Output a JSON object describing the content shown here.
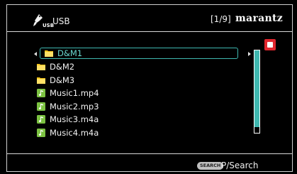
{
  "header": {
    "source_icon": "usb-plug-icon",
    "source_sub_label": "USB",
    "source_name": "USB",
    "page_indicator": "[1/9]",
    "brand": "marantz"
  },
  "list": {
    "items": [
      {
        "label": "D&M1",
        "type": "folder",
        "icon": "folder-icon",
        "selected": true
      },
      {
        "label": "D&M2",
        "type": "folder",
        "icon": "folder-icon",
        "selected": false
      },
      {
        "label": "D&M3",
        "type": "folder",
        "icon": "folder-icon",
        "selected": false
      },
      {
        "label": "Music1.mp4",
        "type": "music",
        "icon": "music-note-icon",
        "selected": false
      },
      {
        "label": "Music2.mp3",
        "type": "music",
        "icon": "music-note-icon",
        "selected": false
      },
      {
        "label": "Music3.m4a",
        "type": "music",
        "icon": "music-note-icon",
        "selected": false
      },
      {
        "label": "Music4.m4a",
        "type": "music",
        "icon": "music-note-icon",
        "selected": false
      }
    ]
  },
  "scrollbar": {
    "position_fraction": 0.0,
    "visible_fraction": 0.93
  },
  "controls": {
    "stop_icon": "stop-icon"
  },
  "footer": {
    "search_key_label": "SEARCH",
    "search_action": "P/Search"
  },
  "colors": {
    "highlight": "#3fb8b0",
    "folder": "#f5c418",
    "music": "#7cc242",
    "stop": "#e0262e"
  }
}
